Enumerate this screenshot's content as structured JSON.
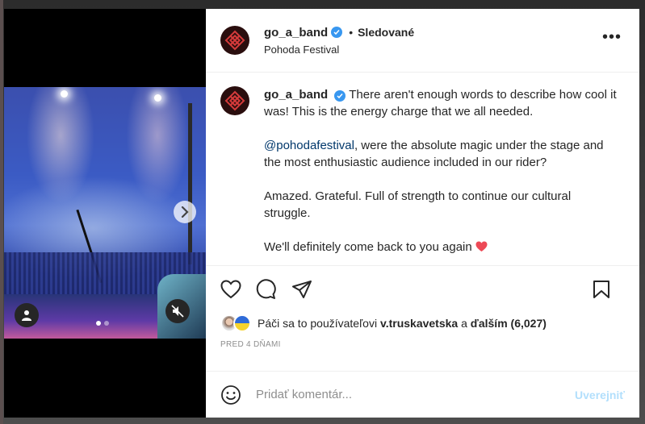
{
  "post": {
    "username": "go_a_band",
    "follow_state": "Sledované",
    "separator": "•",
    "location": "Pohoda Festival",
    "more_label": "•••",
    "carousel": {
      "count": 2,
      "active": 0
    },
    "caption": {
      "line1": "There aren't enough words to describe how cool it was! This is the energy charge that we all needed.",
      "mention": "@pohodafestival",
      "line2_rest": ", were the absolute magic under the stage and the most enthusiastic audience included in our rider?",
      "line3": "Amazed. Grateful. Full of strength to continue our cultural struggle.",
      "line4": "We'll definitely come back to you again",
      "line4_emoji": "❤️"
    },
    "likes": {
      "prefix": "Páči sa to používateľovi",
      "user": "v.truskavetska",
      "middle": "a",
      "others": "ďalším (6,027)"
    },
    "timestamp": "PRED 4 DŇAMI",
    "comment": {
      "placeholder": "Pridať komentár...",
      "value": "",
      "post_label": "Uverejniť"
    }
  },
  "colors": {
    "verified": "#3897f0",
    "mention": "#00376b",
    "post_button_disabled": "#b2dffc",
    "heart_emoji": "#ed4956"
  },
  "icons": [
    "user-tag-icon",
    "mute-icon",
    "chevron-right-icon",
    "heart-icon",
    "comment-icon",
    "share-icon",
    "bookmark-icon",
    "emoji-icon",
    "verified-icon",
    "more-icon"
  ]
}
